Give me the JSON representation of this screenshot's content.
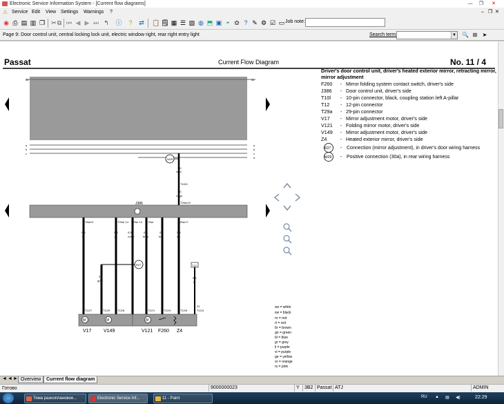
{
  "window": {
    "title": "Electronic Service Information System - [Current flow diagrams]"
  },
  "menu": [
    "Service",
    "Edit",
    "View",
    "Settings",
    "Warnings",
    "?"
  ],
  "toolbar": {
    "job_note_label": "Job note:",
    "job_note_value": ""
  },
  "path": {
    "text": "Page 9: Door control unit, central locking lock unit, electric window right, rear right entry light"
  },
  "search": {
    "label": "Search term:",
    "value": ""
  },
  "diagram": {
    "model": "Passat",
    "heading": "Current Flow Diagram",
    "number": "No.  11 / 4",
    "legend_title": "Driver's door control unit, driver's heated exterior mirror, retracting mirror, mirror adjustment",
    "legend": [
      {
        "code": "F260",
        "desc": "Mirror folding system contact switch, driver's side"
      },
      {
        "code": "J386",
        "desc": "Door control unit, driver's side"
      },
      {
        "code": "T10l",
        "desc": "10-pin connector, black, coupling station left A-pillar"
      },
      {
        "code": "T12",
        "desc": "12-pin connector"
      },
      {
        "code": "T29a",
        "desc": "29-pin connector"
      },
      {
        "code": "V17",
        "desc": "Mirror adjustment motor, driver's side"
      },
      {
        "code": "V121",
        "desc": "Folding mirror motor, driver's side"
      },
      {
        "code": "V149",
        "desc": "Mirror adjustment motor, driver's side"
      },
      {
        "code": "Z4",
        "desc": "Heated exterior mirror, driver's side"
      }
    ],
    "legend_circles": [
      {
        "code": "R27",
        "desc": "Connection (mirror adjustment), in driver's door wiring harness"
      },
      {
        "code": "W29",
        "desc": "Positive connection (30a), in rear wiring harness"
      }
    ],
    "colors": [
      "ws = white",
      "sw = black",
      "ro = red",
      "rt = red",
      "br = brown",
      "gn = green",
      "bl = blue",
      "gr = grey",
      "li = purple",
      "vi = purple",
      "ge = yellow",
      "or = orange",
      "rs = pink"
    ],
    "top_left_num": "30",
    "top_right_num": "30",
    "rails_left": [
      "a",
      "b",
      "c"
    ],
    "rails_right": [
      "a",
      "b",
      "c",
      "d"
    ],
    "w29": "W29",
    "wire_w29": "1,0",
    "wire_w29_color": "rs/bl",
    "t10_label": "T10l/1",
    "wire_t10": "1,0",
    "wire_t10_color": "ro/ge",
    "t29_19": "T29a/19",
    "j386": "J386",
    "pin_labels": [
      "T29a/21",
      "T29a/ 14",
      "T29a/ 13",
      "T29a/",
      "T29a/17"
    ],
    "wires": [
      {
        "size": "0,5",
        "color": "li"
      },
      {
        "size": "0,5",
        "color": "gr"
      },
      {
        "size": "0,5",
        "color": "ro/sw"
      },
      {
        "size": "0,5",
        "color": "br/ro"
      },
      {
        "size": "0,5",
        "color": "br/li"
      },
      {
        "size": "0,5",
        "color": "ws"
      }
    ],
    "gr_li": {
      "size": "0,5",
      "color": "gr/li"
    },
    "r27": "R27",
    "t12_box": "T12",
    "br_wire": {
      "size": "0,5",
      "color": "br"
    },
    "num31": "31",
    "bottom_pins": [
      "T12/7",
      "T12/9",
      "T12/8",
      "T12/1",
      "T12/3",
      "T12/5",
      "T12/4"
    ],
    "components": [
      "V17",
      "V149",
      "V121",
      "F260",
      "Z4"
    ]
  },
  "tabs": [
    "Overview",
    "Current flow diagram"
  ],
  "status": {
    "left": "Готово",
    "doc_no": "9000000023",
    "y": "Y",
    "model_code": "3B2",
    "model": "Passat",
    "engine": "ATJ",
    "user": "ADMIN"
  },
  "taskbar": {
    "tasks": [
      "Тема разноплановое...",
      "Electronic Service Inf...",
      "11 - Paint"
    ],
    "lang": "RU",
    "clock": "22:29"
  }
}
